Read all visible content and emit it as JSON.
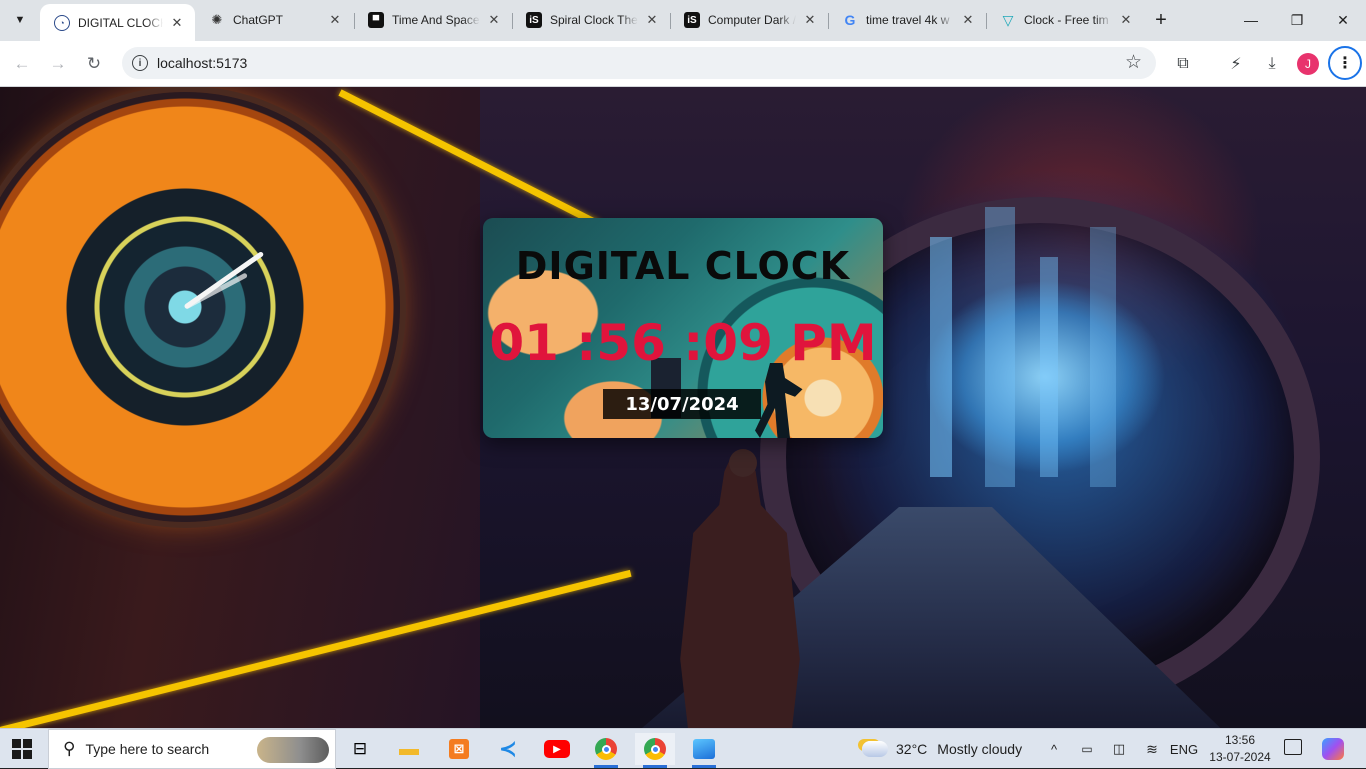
{
  "browser": {
    "tabs": [
      {
        "label": "DIGITAL CLOCK",
        "favicon": "clock-icon",
        "active": true
      },
      {
        "label": "ChatGPT",
        "favicon": "openai-icon",
        "active": false
      },
      {
        "label": "Time And Space",
        "favicon": "unsplash-icon",
        "active": false
      },
      {
        "label": "Spiral Clock The",
        "favicon": "istock-icon",
        "active": false
      },
      {
        "label": "Computer Dark /",
        "favicon": "istock-icon",
        "active": false
      },
      {
        "label": "time travel 4k w",
        "favicon": "google-icon",
        "active": false
      },
      {
        "label": "Clock - Free tim",
        "favicon": "freepik-icon",
        "active": false
      }
    ],
    "url": "localhost:5173",
    "profile_initial": "J",
    "colors": {
      "avatar": "#e8336d",
      "accent": "#1a73e8"
    }
  },
  "page": {
    "title": "DIGITAL CLOCK",
    "time": "01 :56 :09 PM",
    "date": "13/07/2024",
    "colors": {
      "time_text": "#e0143c",
      "title_text": "#0a0a0a",
      "date_bg": "#000000",
      "date_text": "#ffffff"
    }
  },
  "taskbar": {
    "search_placeholder": "Type here to search",
    "weather_temp": "32°C",
    "weather_text": "Mostly cloudy",
    "language": "ENG",
    "clock_time": "13:56",
    "clock_date": "13-07-2024",
    "apps": [
      "task-view-icon",
      "file-explorer-icon",
      "xampp-icon",
      "vscode-icon",
      "youtube-icon",
      "chrome-icon",
      "chrome-icon",
      "photos-icon"
    ]
  }
}
